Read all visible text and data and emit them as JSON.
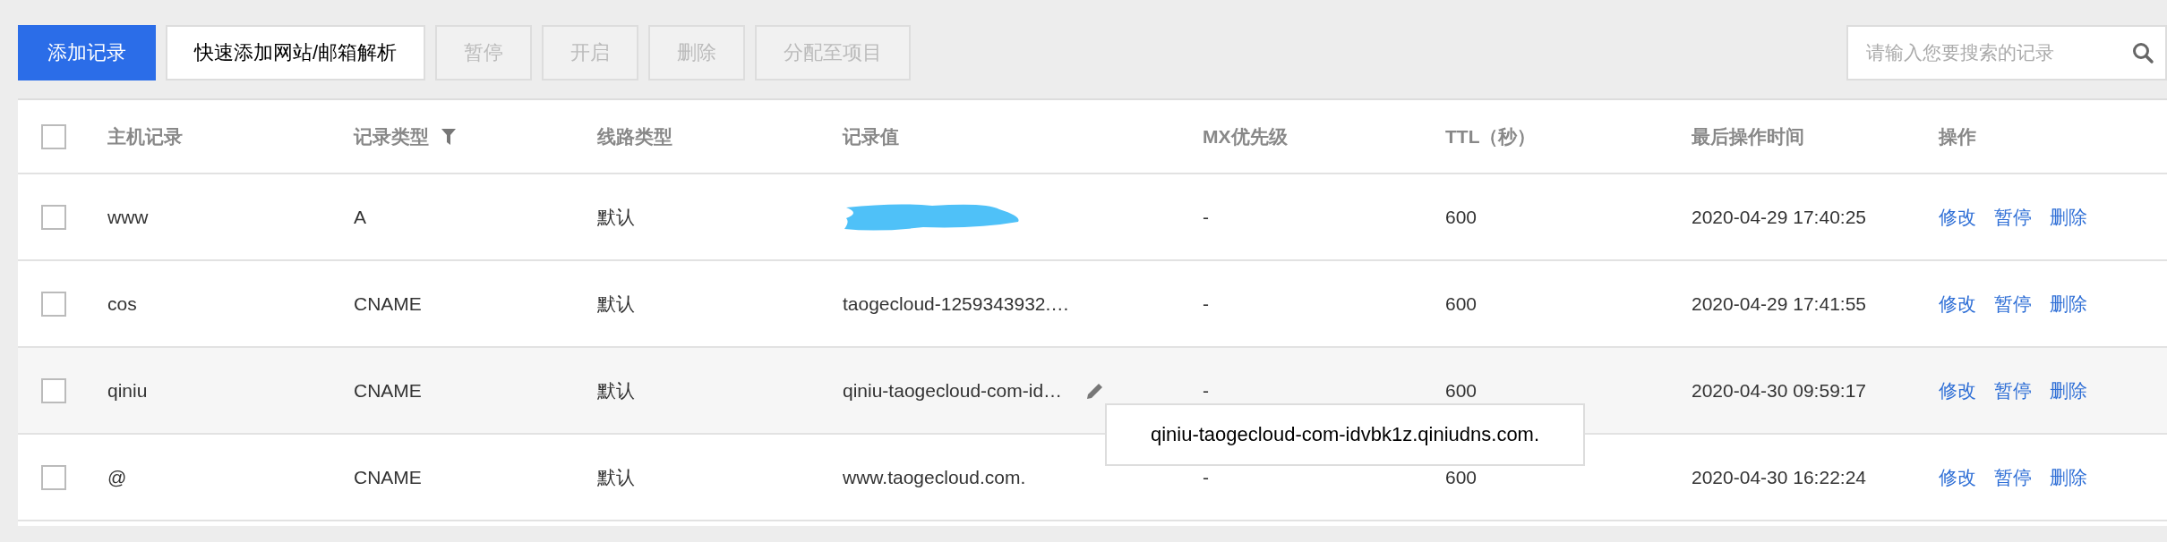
{
  "toolbar": {
    "buttons": [
      {
        "label": "添加记录",
        "kind": "primary",
        "disabled": false
      },
      {
        "label": "快速添加网站/邮箱解析",
        "kind": "default",
        "disabled": false
      },
      {
        "label": "暂停",
        "kind": "default",
        "disabled": true
      },
      {
        "label": "开启",
        "kind": "default",
        "disabled": true
      },
      {
        "label": "删除",
        "kind": "default",
        "disabled": true
      },
      {
        "label": "分配至项目",
        "kind": "default",
        "disabled": true
      }
    ],
    "search": {
      "placeholder": "请输入您要搜索的记录"
    }
  },
  "table": {
    "select_all": {
      "checked": false
    },
    "columns": [
      {
        "label": "主机记录",
        "filterable": false
      },
      {
        "label": "记录类型",
        "filterable": true
      },
      {
        "label": "线路类型",
        "filterable": false
      },
      {
        "label": "记录值",
        "filterable": false
      },
      {
        "label": "MX优先级",
        "filterable": false
      },
      {
        "label": "TTL（秒）",
        "filterable": false
      },
      {
        "label": "最后操作时间",
        "filterable": false
      },
      {
        "label": "操作",
        "filterable": false
      }
    ],
    "rows": [
      {
        "checked": false,
        "hovered": false,
        "host": "www",
        "type": "A",
        "line": "默认",
        "redacted": true,
        "mx": "-",
        "ttl": "600",
        "time": "2020-04-29 17:40:25",
        "actions": [
          "修改",
          "暂停",
          "删除"
        ]
      },
      {
        "checked": false,
        "hovered": false,
        "host": "cos",
        "type": "CNAME",
        "line": "默认",
        "redacted": false,
        "value": "taogecloud-1259343932.…",
        "mx": "-",
        "ttl": "600",
        "time": "2020-04-29 17:41:55",
        "actions": [
          "修改",
          "暂停",
          "删除"
        ]
      },
      {
        "checked": false,
        "hovered": true,
        "host": "qiniu",
        "type": "CNAME",
        "line": "默认",
        "redacted": false,
        "value": "qiniu-taogecloud-com-id…",
        "mx": "-",
        "ttl": "600",
        "time": "2020-04-30 09:59:17",
        "actions": [
          "修改",
          "暂停",
          "删除"
        ]
      },
      {
        "checked": false,
        "hovered": false,
        "host": "@",
        "type": "CNAME",
        "line": "默认",
        "redacted": false,
        "value": "www.taogecloud.com.",
        "mx": "-",
        "ttl": "600",
        "time": "2020-04-30 16:22:24",
        "actions": [
          "修改",
          "暂停",
          "删除"
        ]
      }
    ]
  },
  "tooltip": {
    "text": "qiniu-taogecloud-com-idvbk1z.qiniudns.com."
  }
}
